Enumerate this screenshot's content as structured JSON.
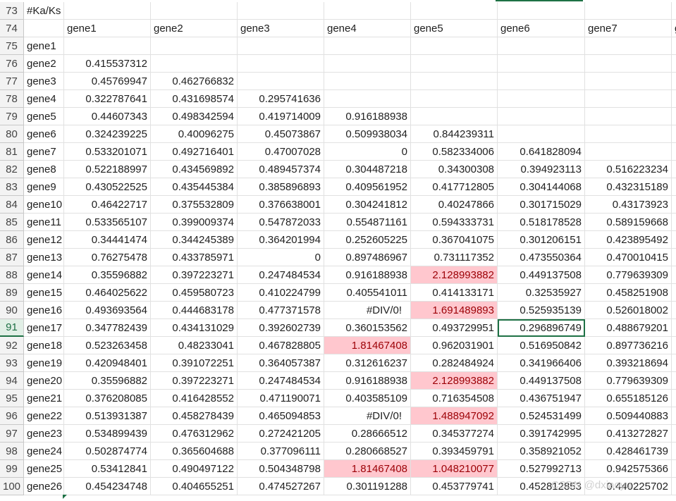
{
  "selected_row": "91",
  "rows": [
    {
      "n": "73",
      "cells": [
        "#Ka/Ks",
        "",
        "",
        "",
        "",
        "",
        "",
        "",
        ""
      ]
    },
    {
      "n": "74",
      "cells": [
        "",
        "gene1",
        "gene2",
        "gene3",
        "gene4",
        "gene5",
        "gene6",
        "gene7",
        "g"
      ]
    },
    {
      "n": "75",
      "cells": [
        "gene1",
        "",
        "",
        "",
        "",
        "",
        "",
        "",
        ""
      ]
    },
    {
      "n": "76",
      "cells": [
        "gene2",
        "0.415537312",
        "",
        "",
        "",
        "",
        "",
        "",
        ""
      ]
    },
    {
      "n": "77",
      "cells": [
        "gene3",
        "0.45769947",
        "0.462766832",
        "",
        "",
        "",
        "",
        "",
        ""
      ]
    },
    {
      "n": "78",
      "cells": [
        "gene4",
        "0.322787641",
        "0.431698574",
        "0.295741636",
        "",
        "",
        "",
        "",
        ""
      ]
    },
    {
      "n": "79",
      "cells": [
        "gene5",
        "0.44607343",
        "0.498342594",
        "0.419714009",
        "0.916188938",
        "",
        "",
        "",
        ""
      ]
    },
    {
      "n": "80",
      "cells": [
        "gene6",
        "0.324239225",
        "0.40096275",
        "0.45073867",
        "0.509938034",
        "0.844239311",
        "",
        "",
        ""
      ]
    },
    {
      "n": "81",
      "cells": [
        "gene7",
        "0.533201071",
        "0.492716401",
        "0.47007028",
        "0",
        "0.582334006",
        "0.641828094",
        "",
        ""
      ]
    },
    {
      "n": "82",
      "cells": [
        "gene8",
        "0.522188997",
        "0.434569892",
        "0.489457374",
        "0.304487218",
        "0.34300308",
        "0.394923113",
        "0.516223234",
        ""
      ]
    },
    {
      "n": "83",
      "cells": [
        "gene9",
        "0.430522525",
        "0.435445384",
        "0.385896893",
        "0.409561952",
        "0.417712805",
        "0.304144068",
        "0.432315189",
        ""
      ]
    },
    {
      "n": "84",
      "cells": [
        "gene10",
        "0.46422717",
        "0.375532809",
        "0.376638001",
        "0.304241812",
        "0.40247866",
        "0.301715029",
        "0.43173923",
        ""
      ]
    },
    {
      "n": "85",
      "cells": [
        "gene11",
        "0.533565107",
        "0.399009374",
        "0.547872033",
        "0.554871161",
        "0.594333731",
        "0.518178528",
        "0.589159668",
        ""
      ]
    },
    {
      "n": "86",
      "cells": [
        "gene12",
        "0.34441474",
        "0.344245389",
        "0.364201994",
        "0.252605225",
        "0.367041075",
        "0.301206151",
        "0.423895492",
        ""
      ]
    },
    {
      "n": "87",
      "cells": [
        "gene13",
        "0.76275478",
        "0.433785971",
        "0",
        "0.897486967",
        "0.731117352",
        "0.473550364",
        "0.470010415",
        ""
      ]
    },
    {
      "n": "88",
      "cells": [
        "gene14",
        "0.35596882",
        "0.397223271",
        "0.247484534",
        "0.916188938",
        "2.128993882",
        "0.449137508",
        "0.779639309",
        ""
      ]
    },
    {
      "n": "89",
      "cells": [
        "gene15",
        "0.464025622",
        "0.459580723",
        "0.410224799",
        "0.405541011",
        "0.414133171",
        "0.32535927",
        "0.458251908",
        ""
      ]
    },
    {
      "n": "90",
      "cells": [
        "gene16",
        "0.493693564",
        "0.444683178",
        "0.477371578",
        "#DIV/0!",
        "1.691489893",
        "0.525935139",
        "0.526018002",
        ""
      ]
    },
    {
      "n": "91",
      "cells": [
        "gene17",
        "0.347782439",
        "0.434131029",
        "0.392602739",
        "0.360153562",
        "0.493729951",
        "0.296896749",
        "0.488679201",
        ""
      ]
    },
    {
      "n": "92",
      "cells": [
        "gene18",
        "0.523263458",
        "0.48233041",
        "0.467828805",
        "1.81467408",
        "0.962031901",
        "0.516950842",
        "0.897736216",
        ""
      ]
    },
    {
      "n": "93",
      "cells": [
        "gene19",
        "0.420948401",
        "0.391072251",
        "0.364057387",
        "0.312616237",
        "0.282484924",
        "0.341966406",
        "0.393218694",
        ""
      ]
    },
    {
      "n": "94",
      "cells": [
        "gene20",
        "0.35596882",
        "0.397223271",
        "0.247484534",
        "0.916188938",
        "2.128993882",
        "0.449137508",
        "0.779639309",
        ""
      ]
    },
    {
      "n": "95",
      "cells": [
        "gene21",
        "0.376208085",
        "0.416428552",
        "0.471190071",
        "0.403585109",
        "0.716354508",
        "0.436751947",
        "0.655185126",
        ""
      ]
    },
    {
      "n": "96",
      "cells": [
        "gene22",
        "0.513931387",
        "0.458278439",
        "0.465094853",
        "#DIV/0!",
        "1.488947092",
        "0.524531499",
        "0.509440883",
        ""
      ]
    },
    {
      "n": "97",
      "cells": [
        "gene23",
        "0.534899439",
        "0.476312962",
        "0.272421205",
        "0.28666512",
        "0.345377274",
        "0.391742995",
        "0.413272827",
        ""
      ]
    },
    {
      "n": "98",
      "cells": [
        "gene24",
        "0.502874774",
        "0.365604688",
        "0.377096111",
        "0.280668527",
        "0.393459791",
        "0.358921052",
        "0.428461739",
        ""
      ]
    },
    {
      "n": "99",
      "cells": [
        "gene25",
        "0.53412841",
        "0.490497122",
        "0.504348798",
        "1.81467408",
        "1.048210077",
        "0.527992713",
        "0.942575366",
        ""
      ]
    },
    {
      "n": "100",
      "cells": [
        "gene26",
        "0.454234748",
        "0.404655251",
        "0.474527267",
        "0.301191288",
        "0.453779741",
        "0.452812853",
        "0.440225702",
        ""
      ]
    }
  ],
  "highlighted": [
    "88.5",
    "90.5",
    "92.4",
    "94.5",
    "96.5",
    "99.4",
    "99.5"
  ],
  "selected_cell": "91.6",
  "colors": {
    "highlight_fill": "#ffc7ce",
    "highlight_text": "#9c0006",
    "selection": "#1e7145"
  },
  "watermark": "CSDN @dxiaoyu"
}
